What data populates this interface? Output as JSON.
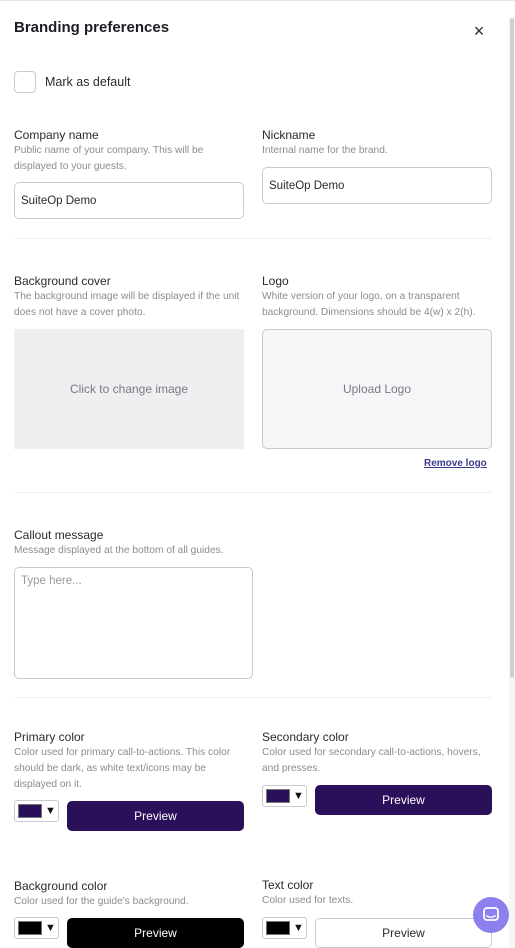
{
  "dialog": {
    "title": "Branding preferences",
    "close_symbol": "×"
  },
  "default_checkbox": {
    "label": "Mark as default",
    "checked": false
  },
  "company": {
    "label": "Company name",
    "help": "Public name of your company. This will be displayed to your guests.",
    "value": "SuiteOp Demo"
  },
  "nickname": {
    "label": "Nickname",
    "help": "Internal name for the brand.",
    "value": "SuiteOp Demo"
  },
  "background_cover": {
    "label": "Background cover",
    "help": "The background image will be displayed if the unit does not have a cover photo.",
    "button": "Click to change image"
  },
  "logo": {
    "label": "Logo",
    "help": "White version of your logo, on a transparent background. Dimensions should be 4(w) x 2(h).",
    "button": "Upload Logo",
    "remove": "Remove logo"
  },
  "callout": {
    "label": "Callout message",
    "help": "Message displayed at the bottom of all guides.",
    "placeholder": "Type here..."
  },
  "primary_color": {
    "label": "Primary color",
    "help": "Color used for primary call-to-actions. This color should be dark, as white text/icons may be displayed on it.",
    "color": "#2a0f5a",
    "preview": "Preview"
  },
  "secondary_color": {
    "label": "Secondary color",
    "help": "Color used for secondary call-to-actions, hovers, and presses.",
    "color": "#2a0f5a",
    "preview": "Preview"
  },
  "background_color": {
    "label": "Background color",
    "help": "Color used for the guide's background.",
    "color": "#000000",
    "preview": "Preview"
  },
  "text_color": {
    "label": "Text color",
    "help": "Color used for texts.",
    "color": "#000000",
    "preview": "Preview"
  },
  "icons": {
    "dropdown": "▼",
    "chat": "chat-icon"
  }
}
